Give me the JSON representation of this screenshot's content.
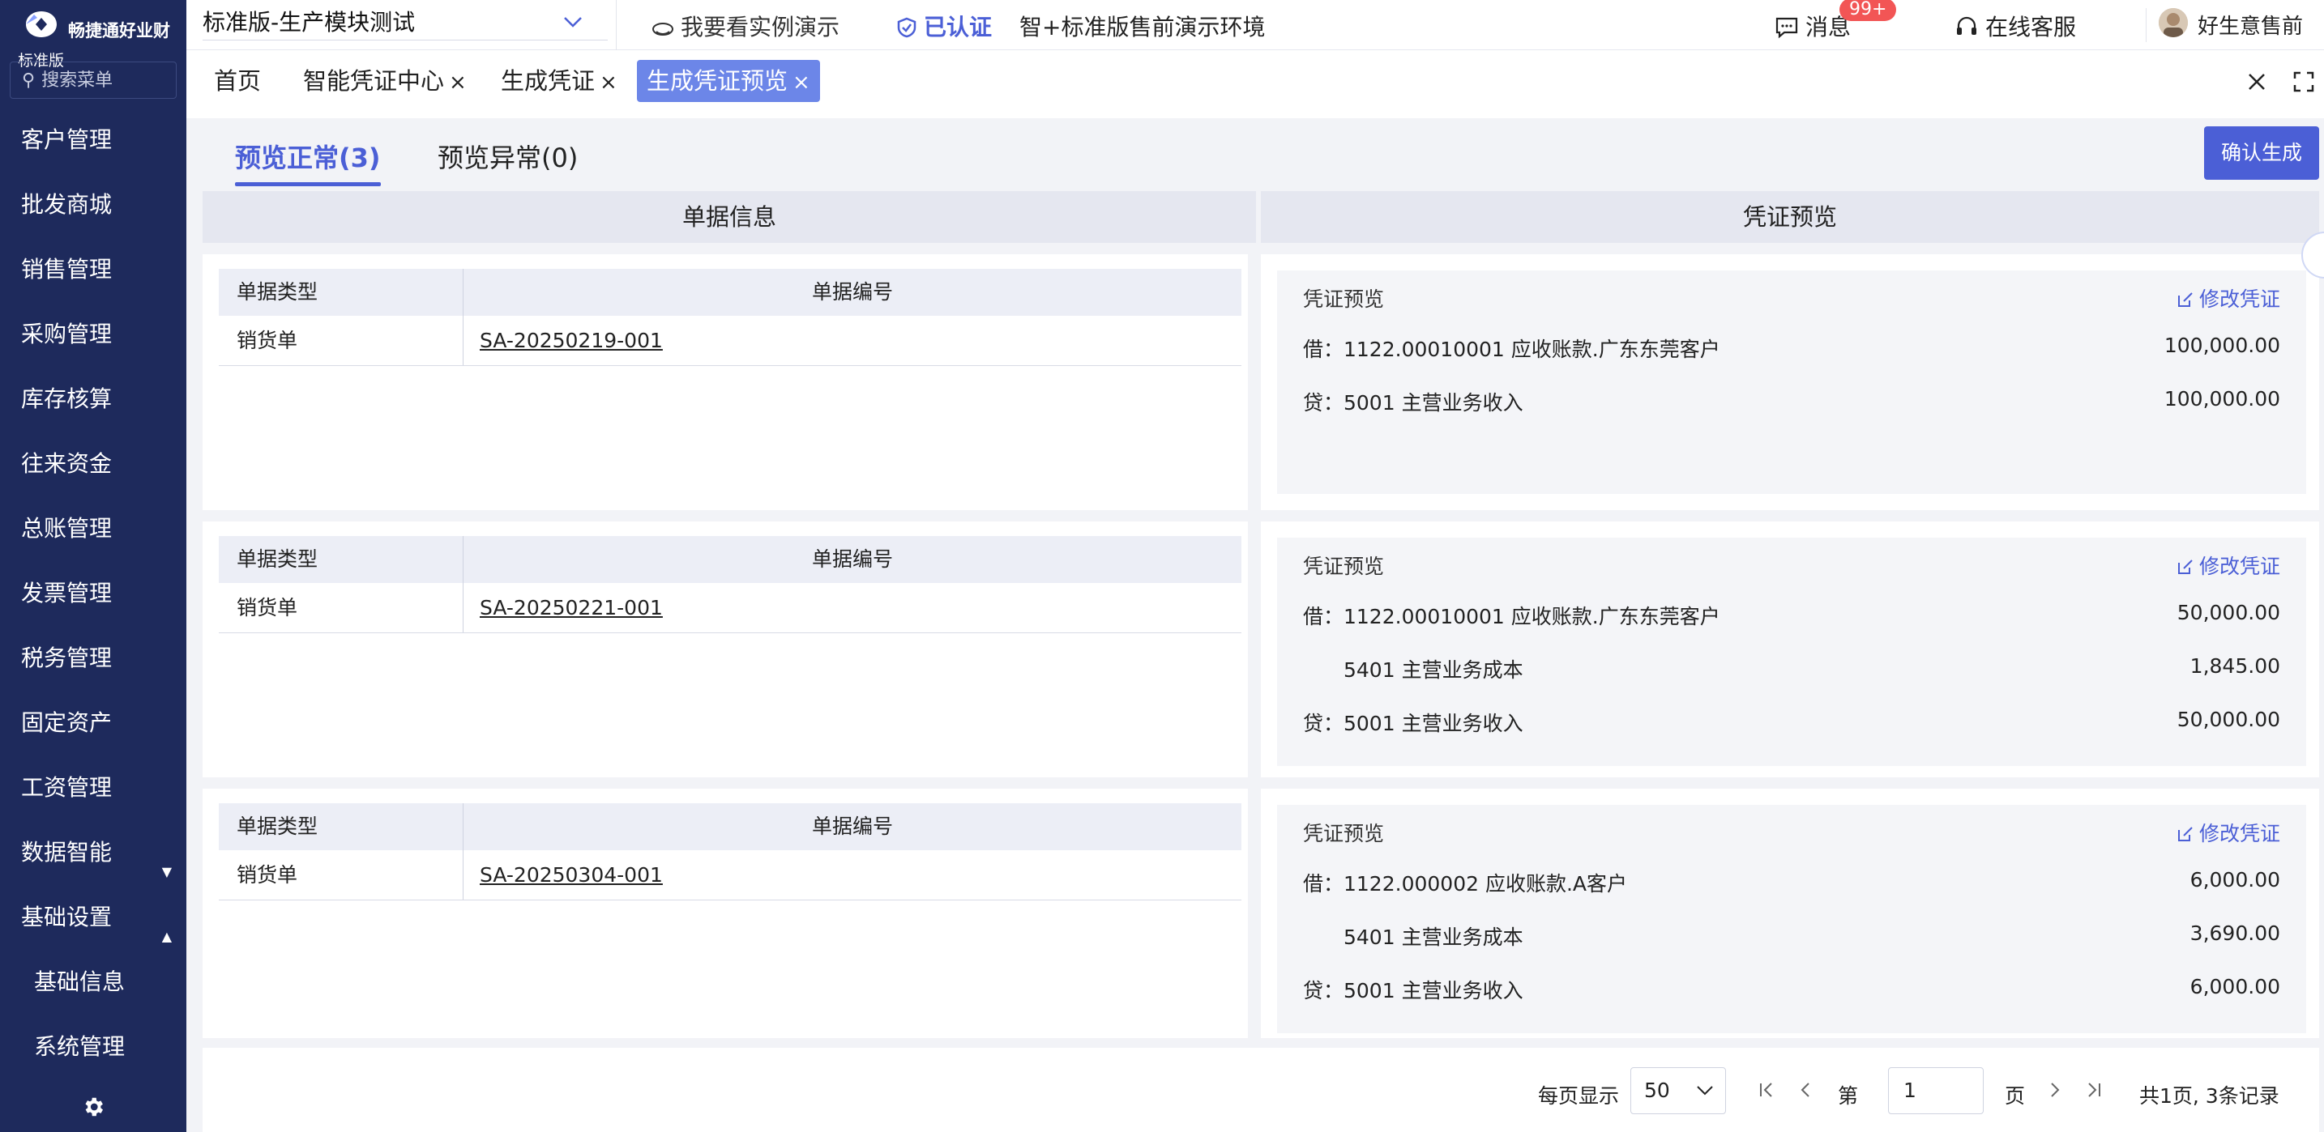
{
  "brand": {
    "name": "畅捷通好业财",
    "edition": "标准版"
  },
  "sidebar": {
    "search_placeholder": "搜索菜单",
    "items": [
      {
        "label": "客户管理"
      },
      {
        "label": "批发商城"
      },
      {
        "label": "销售管理"
      },
      {
        "label": "采购管理"
      },
      {
        "label": "库存核算"
      },
      {
        "label": "往来资金"
      },
      {
        "label": "总账管理"
      },
      {
        "label": "发票管理"
      },
      {
        "label": "税务管理"
      },
      {
        "label": "固定资产"
      },
      {
        "label": "工资管理"
      },
      {
        "label": "数据智能"
      },
      {
        "label": "基础设置"
      },
      {
        "label": "基础信息"
      },
      {
        "label": "系统管理"
      }
    ]
  },
  "topbar": {
    "org_name": "标准版-生产模块测试",
    "demo_link": "我要看实例演示",
    "verified": "已认证",
    "env": "智+标准版售前演示环境",
    "messages": "消息",
    "messages_badge": "99+",
    "online_service": "在线客服",
    "user": "好生意售前"
  },
  "tabs": [
    {
      "label": "首页"
    },
    {
      "label": "智能凭证中心",
      "close": "×"
    },
    {
      "label": "生成凭证",
      "close": "×"
    },
    {
      "label": "生成凭证预览",
      "close": "×"
    }
  ],
  "content": {
    "subtabs": [
      {
        "label": "预览正常(3)"
      },
      {
        "label": "预览异常(0)"
      }
    ],
    "confirm_button": "确认生成",
    "left_header": "单据信息",
    "right_header": "凭证预览",
    "doc_col_type": "单据类型",
    "doc_col_no": "单据编号",
    "voucher_title": "凭证预览",
    "edit_label": "修改凭证",
    "records": [
      {
        "type": "销货单",
        "number": "SA-20250219-001",
        "lines": [
          {
            "account": "借：1122.00010001 应收账款.广东东莞客户",
            "amount": "100,000.00"
          },
          {
            "account": "贷：5001 主营业务收入",
            "amount": "100,000.00"
          }
        ]
      },
      {
        "type": "销货单",
        "number": "SA-20250221-001",
        "lines": [
          {
            "account": "借：1122.00010001 应收账款.广东东莞客户",
            "amount": "50,000.00"
          },
          {
            "account": "5401 主营业务成本",
            "amount": "1,845.00"
          },
          {
            "account": "贷：5001 主营业务收入",
            "amount": "50,000.00"
          }
        ]
      },
      {
        "type": "销货单",
        "number": "SA-20250304-001",
        "lines": [
          {
            "account": "借：1122.000002 应收账款.A客户",
            "amount": "6,000.00"
          },
          {
            "account": "5401 主营业务成本",
            "amount": "3,690.00"
          },
          {
            "account": "贷：5001 主营业务收入",
            "amount": "6,000.00"
          }
        ]
      }
    ]
  },
  "pagination": {
    "per_page_label": "每页显示",
    "per_page": "50",
    "page_prefix": "第",
    "page": "1",
    "page_suffix": "页",
    "total": "共1页, 3条记录"
  }
}
